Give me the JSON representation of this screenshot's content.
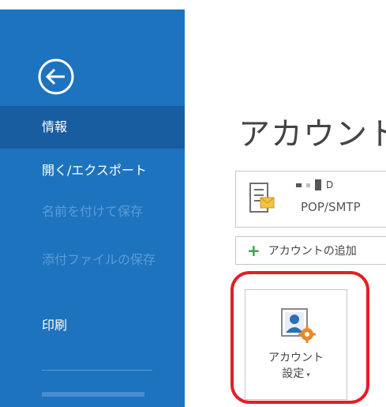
{
  "sidebar": {
    "items": [
      {
        "label": "情報",
        "selected": true,
        "enabled": true
      },
      {
        "label": "開く/エクスポート",
        "enabled": true
      },
      {
        "label": "名前を付けて保存",
        "enabled": false
      },
      {
        "label": "添付ファイルの保存",
        "enabled": false
      },
      {
        "label": "印刷",
        "enabled": true
      }
    ],
    "back_icon": "back-arrow-icon"
  },
  "main": {
    "title": "アカウント",
    "account": {
      "name_suffix": "D",
      "type": "POP/SMTP",
      "icon": "mail-account-icon"
    },
    "add_account_label": "アカウントの追加",
    "account_settings": {
      "line1": "アカウント",
      "line2": "設定",
      "caret": "▾",
      "icon": "account-settings-icon"
    }
  },
  "colors": {
    "sidebar": "#1e73be",
    "highlight": "#e41e26",
    "add_plus": "#3aa04c"
  }
}
